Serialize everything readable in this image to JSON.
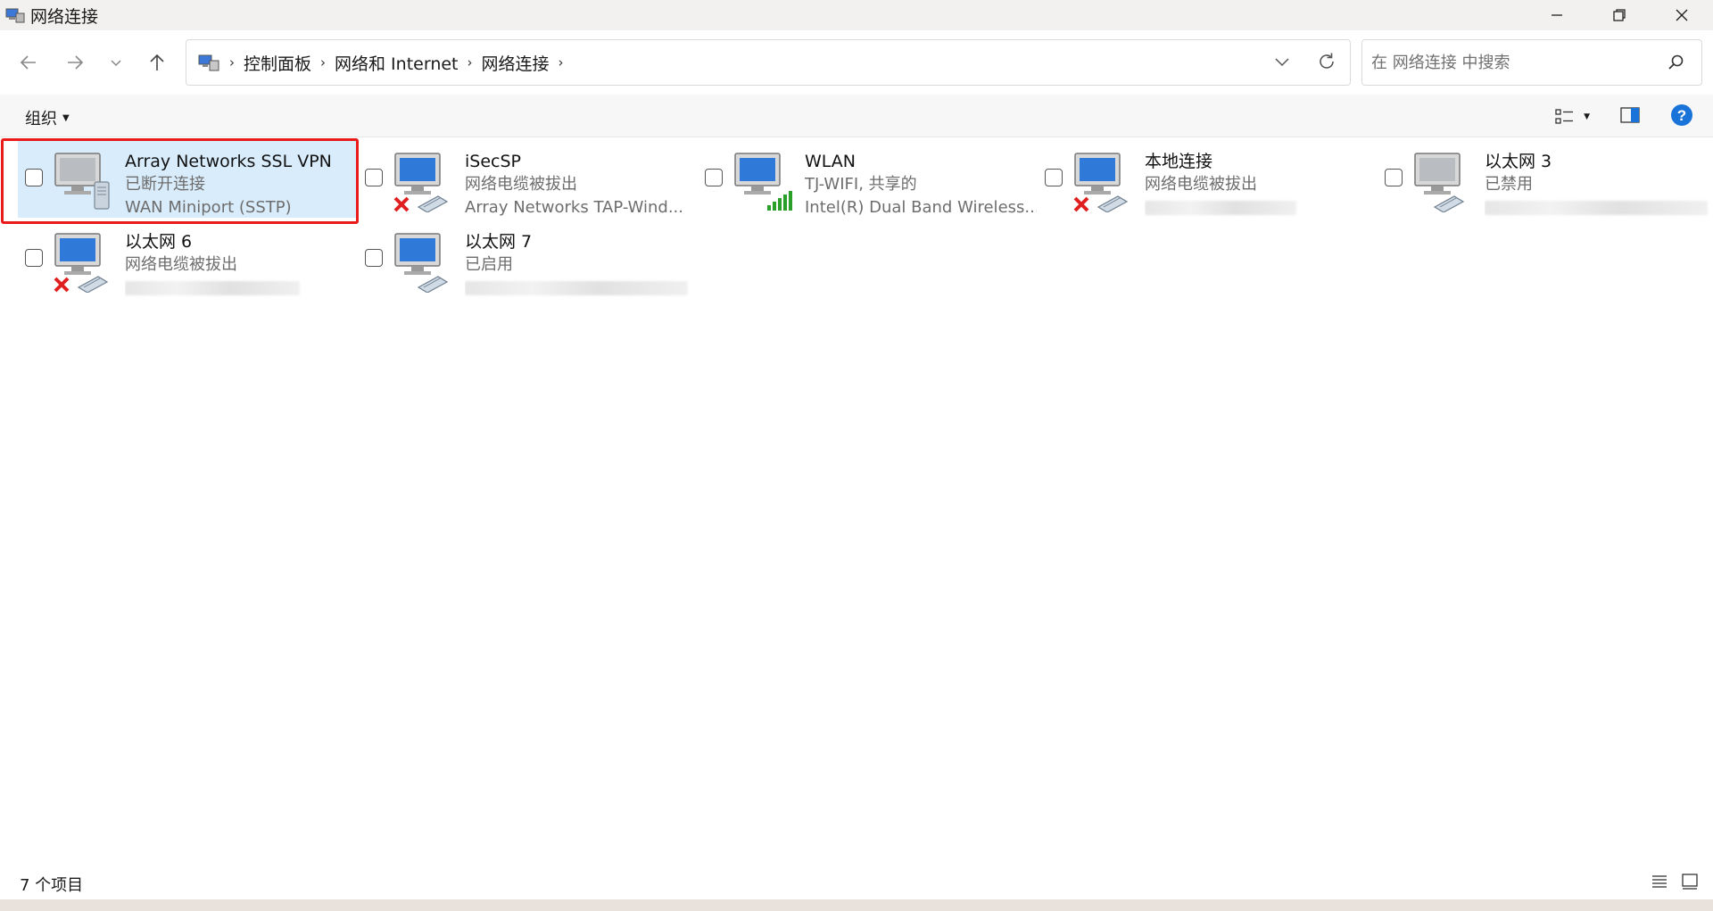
{
  "window": {
    "title": "网络连接",
    "controls": {
      "minimize": "minimize-icon",
      "restore": "restore-icon",
      "close": "close-icon"
    }
  },
  "address_bar": {
    "breadcrumbs": [
      "控制面板",
      "网络和 Internet",
      "网络连接"
    ],
    "search_placeholder": "在 网络连接 中搜索"
  },
  "command_bar": {
    "organize_label": "组织"
  },
  "connections": [
    {
      "name": "Array Networks SSL VPN",
      "status": "已断开连接",
      "device": "WAN Miniport (SSTP)",
      "badge": "vpn",
      "selected": true
    },
    {
      "name": "iSecSP",
      "status": "网络电缆被拔出",
      "device": "Array Networks TAP-Wind...",
      "badge": "disconnected",
      "selected": false
    },
    {
      "name": "WLAN",
      "status": "TJ-WIFI, 共享的",
      "device": "Intel(R) Dual Band Wireless...",
      "badge": "wifi",
      "selected": false
    },
    {
      "name": "本地连接",
      "status": "网络电缆被拔出",
      "device": "",
      "badge": "disconnected",
      "selected": false
    },
    {
      "name": "以太网 3",
      "status": "已禁用",
      "device": "",
      "badge": "disabled",
      "selected": false
    },
    {
      "name": "以太网 6",
      "status": "网络电缆被拔出",
      "device": "",
      "badge": "disconnected",
      "selected": false
    },
    {
      "name": "以太网 7",
      "status": "已启用",
      "device": "",
      "badge": "enabled",
      "selected": false
    }
  ],
  "status_bar": {
    "item_count": "7 个项目"
  },
  "colors": {
    "selection_bg": "#d9ecfb",
    "highlight_border": "#e81a1a",
    "help_blue": "#1a73d9"
  }
}
